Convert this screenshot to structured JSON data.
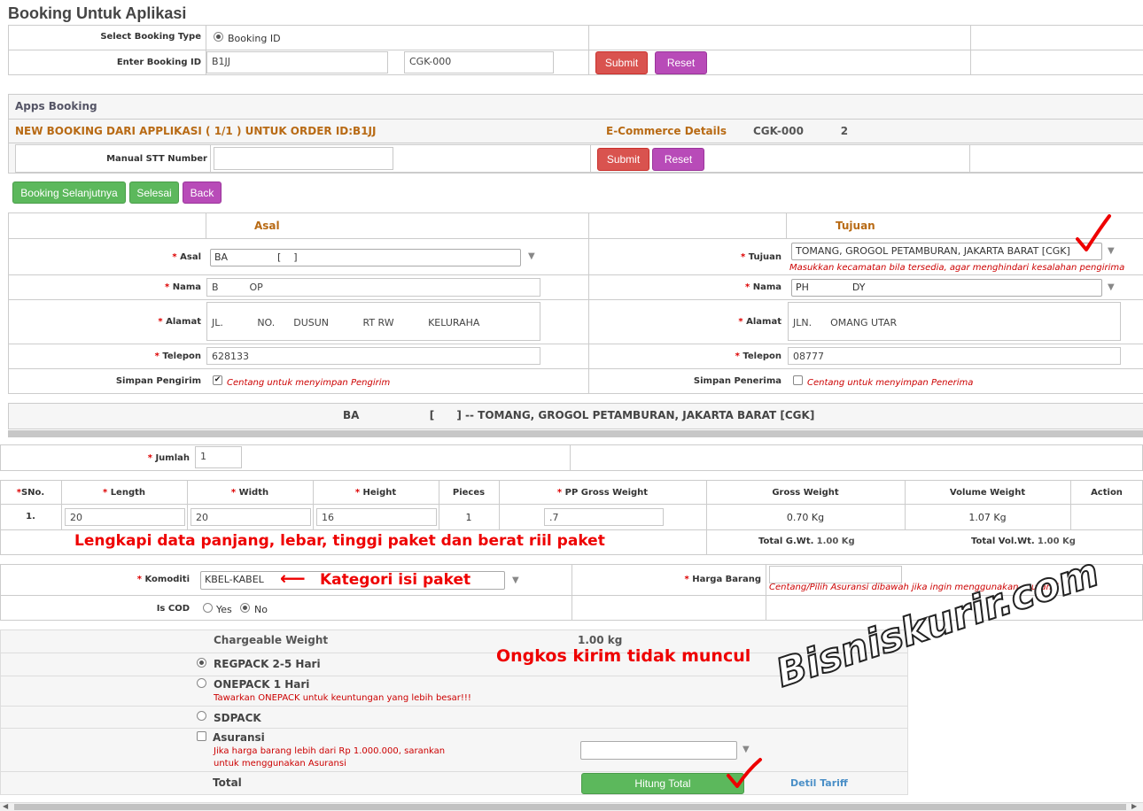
{
  "page": {
    "title": "Booking Untuk Aplikasi"
  },
  "booking_type": {
    "label": "Select Booking Type",
    "option": "Booking ID"
  },
  "booking_id": {
    "label": "Enter Booking ID",
    "value1": "B1JJ",
    "value2": "CGK-000",
    "submit": "Submit",
    "reset": "Reset"
  },
  "apps_booking": {
    "title": "Apps Booking",
    "new_booking": "NEW BOOKING DARI APPLIKASI ( 1/1 ) UNTUK ORDER ID:B1JJ",
    "ecommerce_label": "E-Commerce Details",
    "ecommerce_value": "CGK-000          2",
    "manual_stt_label": "Manual STT Number",
    "submit": "Submit",
    "reset": "Reset"
  },
  "actions": {
    "next": "Booking Selanjutnya",
    "done": "Selesai",
    "back": "Back"
  },
  "asal": {
    "header": "Asal",
    "asal_label": "Asal",
    "asal_value": "BA                [    ]",
    "nama_label": "Nama",
    "nama_value": "B          OP",
    "alamat_label": "Alamat",
    "alamat_value": "JL.           NO.      DUSUN           RT RW           KELURAHA",
    "telepon_label": "Telepon",
    "telepon_value": "628133",
    "simpan_label": "Simpan Pengirim",
    "simpan_note": "Centang untuk menyimpan Pengirim"
  },
  "tujuan": {
    "header": "Tujuan",
    "tujuan_label": "Tujuan",
    "tujuan_value": "TOMANG, GROGOL PETAMBURAN, JAKARTA BARAT [CGK]",
    "tujuan_hint": "Masukkan kecamatan bila tersedia, agar menghindari kesalahan pengirima",
    "nama_label": "Nama",
    "nama_value": "PH              DY",
    "alamat_label": "Alamat",
    "alamat_value": "JLN.      OMANG UTAR",
    "telepon_label": "Telepon",
    "telepon_value": "08777",
    "simpan_label": "Simpan Penerima",
    "simpan_note": "Centang untuk menyimpan Penerima"
  },
  "route": {
    "text": "BA                   [      ] -- TOMANG, GROGOL PETAMBURAN, JAKARTA BARAT [CGK]"
  },
  "jumlah": {
    "label": "Jumlah",
    "value": "1"
  },
  "pieces_table": {
    "headers": [
      "SNo.",
      "Length",
      "Width",
      "Height",
      "Pieces",
      "PP Gross Weight",
      "Gross Weight",
      "Volume Weight",
      "Action"
    ],
    "row": {
      "sno": "1.",
      "length": "20",
      "width": "20",
      "height": "16",
      "pieces": "1",
      "pp_gross": ".7",
      "gross": "0.70 Kg",
      "volume": "1.07 Kg"
    },
    "total_gwt_label": "Total G.Wt.",
    "total_gwt_value": "1.00 Kg",
    "total_vol_label": "Total Vol.Wt.",
    "total_vol_value": "1.00 Kg"
  },
  "komoditi": {
    "label": "Komoditi",
    "value": "KBEL-KABEL",
    "cod_label": "Is COD",
    "yes": "Yes",
    "no": "No"
  },
  "harga": {
    "label": "Harga Barang",
    "hint": "Centang/Pilih Asuransi dibawah jika ingin menggunakan asuransi"
  },
  "services": {
    "chargeable_label": "Chargeable Weight",
    "chargeable_value": "1.00 kg",
    "regpack": "REGPACK 2-5 Hari",
    "onepack": "ONEPACK 1 Hari",
    "onepack_hint": "Tawarkan ONEPACK untuk keuntungan yang lebih besar!!!",
    "sdpack": "SDPACK",
    "asuransi": "Asuransi",
    "asuransi_hint_1": "Jika harga barang lebih dari Rp 1.000.000, sarankan",
    "asuransi_hint_2": "untuk menggunakan Asuransi",
    "total_label": "Total",
    "hitung": "Hitung Total",
    "detil": "Detil Tariff"
  },
  "annotations": {
    "a1": "Lengkapi data panjang, lebar, tinggi paket dan berat riil paket",
    "a2": "Kategori isi paket",
    "a3": "Ongkos kirim tidak muncul",
    "watermark": "Bisniskurir.com"
  }
}
